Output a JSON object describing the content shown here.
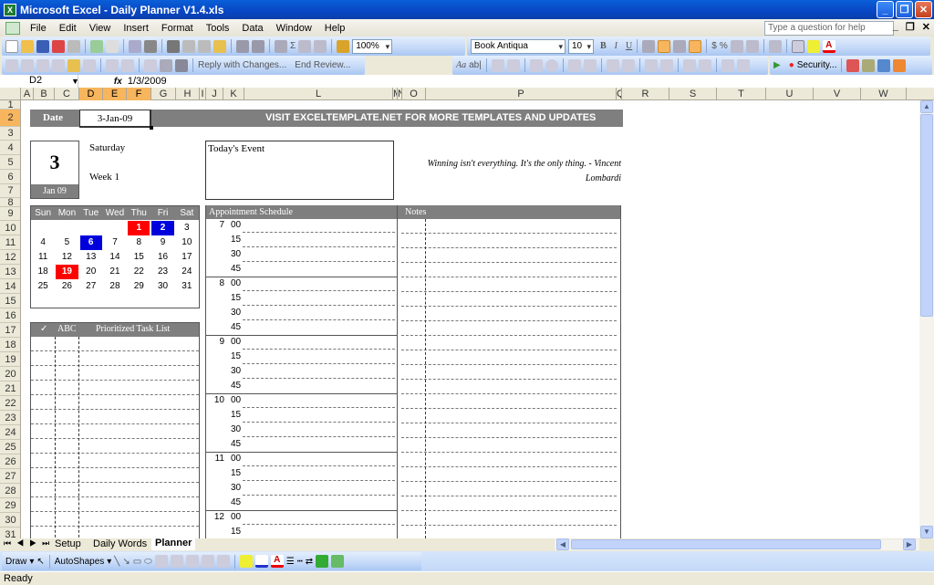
{
  "window": {
    "title": "Microsoft Excel - Daily Planner V1.4.xls",
    "controls": [
      "minimize",
      "restore",
      "close"
    ]
  },
  "menu": {
    "items": [
      "File",
      "Edit",
      "View",
      "Insert",
      "Format",
      "Tools",
      "Data",
      "Window",
      "Help"
    ],
    "help_placeholder": "Type a question for help"
  },
  "toolbar": {
    "zoom": "100%",
    "font_name": "Book Antiqua",
    "font_size": "10",
    "bold": "B",
    "italic": "I",
    "underline": "U",
    "currency": "$",
    "percent": "%",
    "reply_changes": "Reply with Changes...",
    "end_review": "End Review...",
    "security": "Security..."
  },
  "formula_bar": {
    "name_box": "D2",
    "fx": "fx",
    "formula": "1/3/2009"
  },
  "columns": [
    "A",
    "B",
    "C",
    "D",
    "E",
    "F",
    "G",
    "H",
    "I",
    "J",
    "K",
    "L",
    "M",
    "N",
    "O",
    "P",
    "Q",
    "R",
    "S",
    "T",
    "U",
    "V",
    "W"
  ],
  "selected_columns": [
    "D",
    "E",
    "F"
  ],
  "rows": [
    "1",
    "2",
    "3",
    "4",
    "5",
    "6",
    "7",
    "8",
    "9",
    "10",
    "11",
    "12",
    "13",
    "14",
    "15",
    "16",
    "17",
    "18",
    "19",
    "20",
    "21",
    "22",
    "23",
    "24",
    "25",
    "26",
    "27",
    "28",
    "29",
    "30",
    "31"
  ],
  "selected_row": "2",
  "planner": {
    "date_label": "Date",
    "date_value": "3-Jan-09",
    "banner": "VISIT EXCELTEMPLATE.NET FOR MORE TEMPLATES AND UPDATES",
    "day_number": "3",
    "month_year": "Jan 09",
    "weekday": "Saturday",
    "week": "Week 1",
    "event_label": "Today's Event",
    "quote": "Winning isn't everything. It's the only thing. - Vincent Lombardi",
    "quote_line1": "Winning isn't everything. It's the only thing. - Vincent",
    "quote_line2": "Lombardi",
    "calendar": {
      "headers": [
        "Sun",
        "Mon",
        "Tue",
        "Wed",
        "Thu",
        "Fri",
        "Sat"
      ],
      "weeks": [
        [
          "",
          "",
          "",
          "",
          "1",
          "2",
          "3"
        ],
        [
          "4",
          "5",
          "6",
          "7",
          "8",
          "9",
          "10"
        ],
        [
          "11",
          "12",
          "13",
          "14",
          "15",
          "16",
          "17"
        ],
        [
          "18",
          "19",
          "20",
          "21",
          "22",
          "23",
          "24"
        ],
        [
          "25",
          "26",
          "27",
          "28",
          "29",
          "30",
          "31"
        ]
      ],
      "highlights": {
        "1": "#ff0000",
        "2": "#0000dd",
        "6": "#0000dd",
        "19": "#ff0000"
      }
    },
    "tasks": {
      "check_header": "✓",
      "abc_header": "ABC",
      "title": "Prioritized Task List"
    },
    "schedule": {
      "title": "Appointment Schedule",
      "hours": [
        "7",
        "8",
        "9",
        "10",
        "11",
        "12"
      ],
      "minutes": [
        "00",
        "15",
        "30",
        "45"
      ]
    },
    "notes_title": "Notes"
  },
  "sheet_tabs": [
    "Setup",
    "Daily Words",
    "Planner"
  ],
  "active_tab": "Planner",
  "draw_toolbar": {
    "draw": "Draw",
    "autoshapes": "AutoShapes"
  },
  "status": "Ready",
  "colors": {
    "header_gray": "#7f7f7f",
    "highlight_red": "#ff0000",
    "highlight_blue": "#0000dd",
    "selection_orange": "#f7b55d",
    "title_blue": "#0846c4"
  }
}
